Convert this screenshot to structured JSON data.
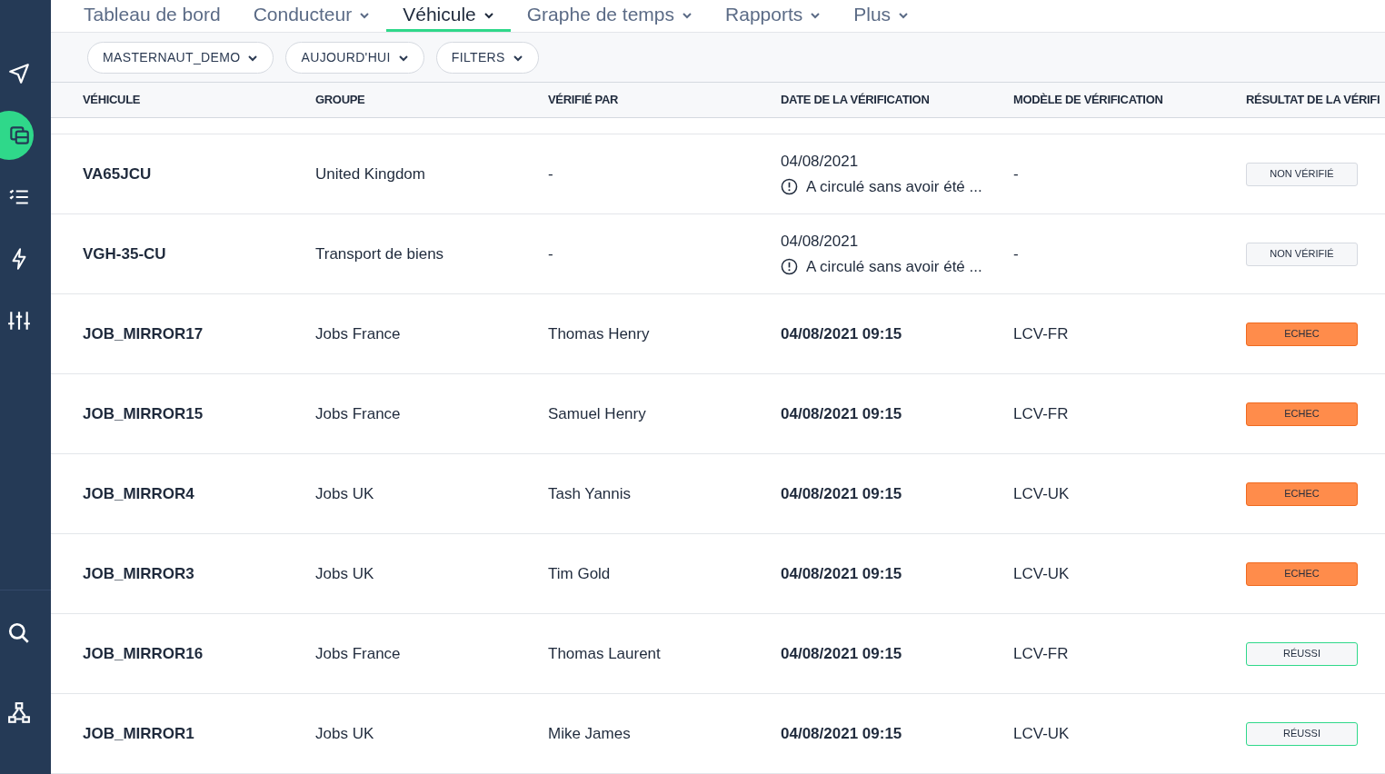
{
  "sidebar": {
    "items": [
      {
        "selected": false
      },
      {
        "selected": true
      },
      {
        "selected": false
      },
      {
        "selected": false
      },
      {
        "selected": false
      }
    ],
    "bottom_items": [
      {
        "selected": false
      },
      {
        "selected": false
      }
    ]
  },
  "tabs": [
    {
      "label": "Tableau de bord",
      "dropdown": false,
      "selected": false
    },
    {
      "label": "Conducteur",
      "dropdown": true,
      "selected": false
    },
    {
      "label": "Véhicule",
      "dropdown": true,
      "selected": true
    },
    {
      "label": "Graphe de temps",
      "dropdown": true,
      "selected": false
    },
    {
      "label": "Rapports",
      "dropdown": true,
      "selected": false
    },
    {
      "label": "Plus",
      "dropdown": true,
      "selected": false
    }
  ],
  "filters": [
    "MASTERNAUT_DEMO",
    "AUJOURD'HUI",
    "FILTERS"
  ],
  "table": {
    "columns": [
      "VÉHICULE",
      "GROUPE",
      "VÉRIFIÉ PAR",
      "DATE DE LA VÉRIFICATION",
      "MODÈLE DE VÉRIFICATION",
      "RÉSULTAT DE LA VÉRIFI"
    ],
    "rows": [
      {
        "vehicle": "VA65JCU",
        "group": "United Kingdom",
        "checked_by": "-",
        "date": "04/08/2021",
        "note": "A circulé sans avoir été ...",
        "template": "-",
        "result": {
          "kind": "unverified",
          "label": "NON VÉRIFIÉ"
        }
      },
      {
        "vehicle": "VGH-35-CU",
        "group": "Transport de biens",
        "checked_by": "-",
        "date": "04/08/2021",
        "note": "A circulé sans avoir été ...",
        "template": "-",
        "result": {
          "kind": "unverified",
          "label": "NON VÉRIFIÉ"
        }
      },
      {
        "vehicle": "JOB_MIRROR17",
        "group": "Jobs France",
        "checked_by": "Thomas Henry",
        "date": "04/08/2021 09:15",
        "template": "LCV-FR",
        "result": {
          "kind": "fail",
          "label": "ECHEC"
        }
      },
      {
        "vehicle": "JOB_MIRROR15",
        "group": "Jobs France",
        "checked_by": "Samuel Henry",
        "date": "04/08/2021 09:15",
        "template": "LCV-FR",
        "result": {
          "kind": "fail",
          "label": "ECHEC"
        }
      },
      {
        "vehicle": "JOB_MIRROR4",
        "group": "Jobs UK",
        "checked_by": "Tash Yannis",
        "date": "04/08/2021 09:15",
        "template": "LCV-UK",
        "result": {
          "kind": "fail",
          "label": "ECHEC"
        }
      },
      {
        "vehicle": "JOB_MIRROR3",
        "group": "Jobs UK",
        "checked_by": "Tim Gold",
        "date": "04/08/2021 09:15",
        "template": "LCV-UK",
        "result": {
          "kind": "fail",
          "label": "ECHEC"
        }
      },
      {
        "vehicle": "JOB_MIRROR16",
        "group": "Jobs France",
        "checked_by": "Thomas Laurent",
        "date": "04/08/2021 09:15",
        "template": "LCV-FR",
        "result": {
          "kind": "pass",
          "label": "RÉUSSI"
        }
      },
      {
        "vehicle": "JOB_MIRROR1",
        "group": "Jobs UK",
        "checked_by": "Mike James",
        "date": "04/08/2021 09:15",
        "template": "LCV-UK",
        "result": {
          "kind": "pass",
          "label": "RÉUSSI"
        }
      }
    ]
  }
}
